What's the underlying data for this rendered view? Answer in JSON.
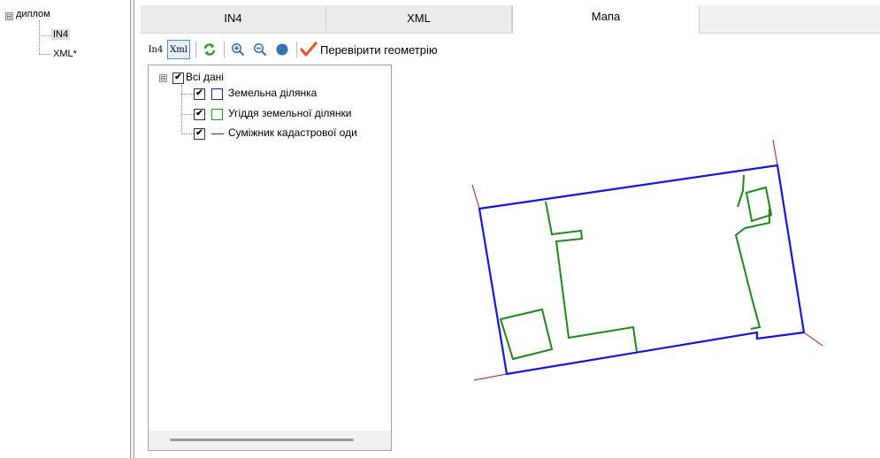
{
  "project_tree": {
    "root": {
      "label": "диплом",
      "expander": "⊟"
    },
    "children": [
      {
        "label": "IN4",
        "selected": true
      },
      {
        "label": "XML*",
        "selected": false
      }
    ]
  },
  "tabs": [
    {
      "label": "IN4",
      "active": false
    },
    {
      "label": "XML",
      "active": false
    },
    {
      "label": "Мапа",
      "active": true
    }
  ],
  "toolbar": {
    "in4_label": "In4",
    "xml_label": "Xml",
    "icons": [
      "refresh-icon",
      "zoom-in-icon",
      "zoom-out-icon",
      "globe-icon",
      "checkmark-icon"
    ],
    "check_geometry_label": "Перевірити геометрію"
  },
  "layers": {
    "root": {
      "label": "Всі дані",
      "checked": true,
      "expander": "⊟"
    },
    "items": [
      {
        "label": "Земельна ділянка",
        "checked": true,
        "symbol": "blue-square-icon",
        "color": "#1a1ae6"
      },
      {
        "label": "Угіддя земельної ділянки",
        "checked": true,
        "symbol": "green-square-icon",
        "color": "#1a9a1a"
      },
      {
        "label": "Суміжник кадастрової оди",
        "checked": true,
        "symbol": "red-line-icon",
        "color": "#a01010"
      }
    ]
  },
  "colors": {
    "parcel": "#1515e0",
    "lands": "#1b8a1b",
    "neighbor": "#b01818"
  }
}
